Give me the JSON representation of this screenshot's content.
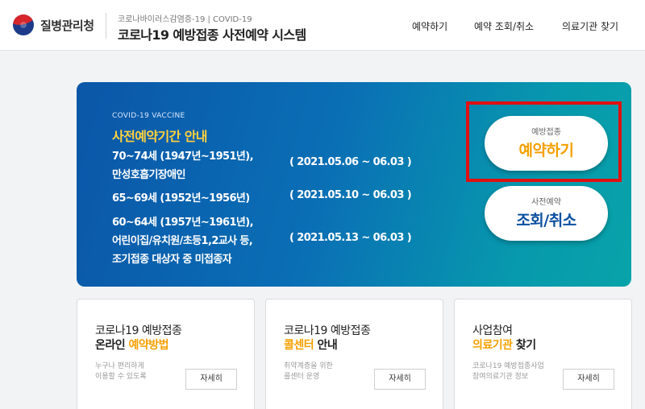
{
  "header": {
    "logo_text": "질병관리청",
    "subtitle": "코로나바이러스감염증-19 | COVID-19",
    "title": "코로나19 예방접종 사전예약 시스템",
    "nav": [
      "예약하기",
      "예약 조회/취소",
      "의료기관 찾기"
    ]
  },
  "banner": {
    "eyebrow": "COVID-19 VACCINE",
    "heading": "사전예약기간 안내",
    "lines": [
      "70~74세 (1947년~1951년),",
      "만성호흡기장애인",
      "( 2021.05.06 ~ 06.03 )",
      "65~69세 (1952년~1956년)",
      "( 2021.05.10 ~ 06.03 )",
      "60~64세 (1957년~1961년),",
      "어린이집/유치원/초등1,2교사 등,",
      "( 2021.05.13 ~ 06.03 )",
      "조기접종 대상자 중 미접종자"
    ],
    "book_button": {
      "small": "예방접종",
      "big": "예약하기"
    },
    "lookup_button": {
      "small": "사전예약",
      "big": "조회/취소"
    }
  },
  "cards": [
    {
      "title_line1": "코로나19 예방접종",
      "title_line2_plain": "온라인 ",
      "title_line2_highlight": "예약방법",
      "title_line2_suffix": "",
      "desc": [
        "누구나 편리하게",
        "이용할 수 있도록"
      ],
      "button": "자세히"
    },
    {
      "title_line1": "코로나19 예방접종",
      "title_line2_plain": "",
      "title_line2_highlight": "콜센터",
      "title_line2_suffix": " 안내",
      "desc": [
        "취약계층을 위한",
        "콜센터 운영"
      ],
      "button": "자세히"
    },
    {
      "title_line1": "사업참여",
      "title_line2_plain": "",
      "title_line2_highlight": "의료기관",
      "title_line2_suffix": " 찾기",
      "desc": [
        "코로나19 예방접종사업",
        "참여의료기관 정보"
      ],
      "button": "자세히"
    }
  ],
  "colors": {
    "highlight": "#f5a000",
    "banner_heading": "#ffd23c",
    "book_text": "#f5a000",
    "lookup_text": "#0a4fa0",
    "frame_red": "#e01010"
  }
}
